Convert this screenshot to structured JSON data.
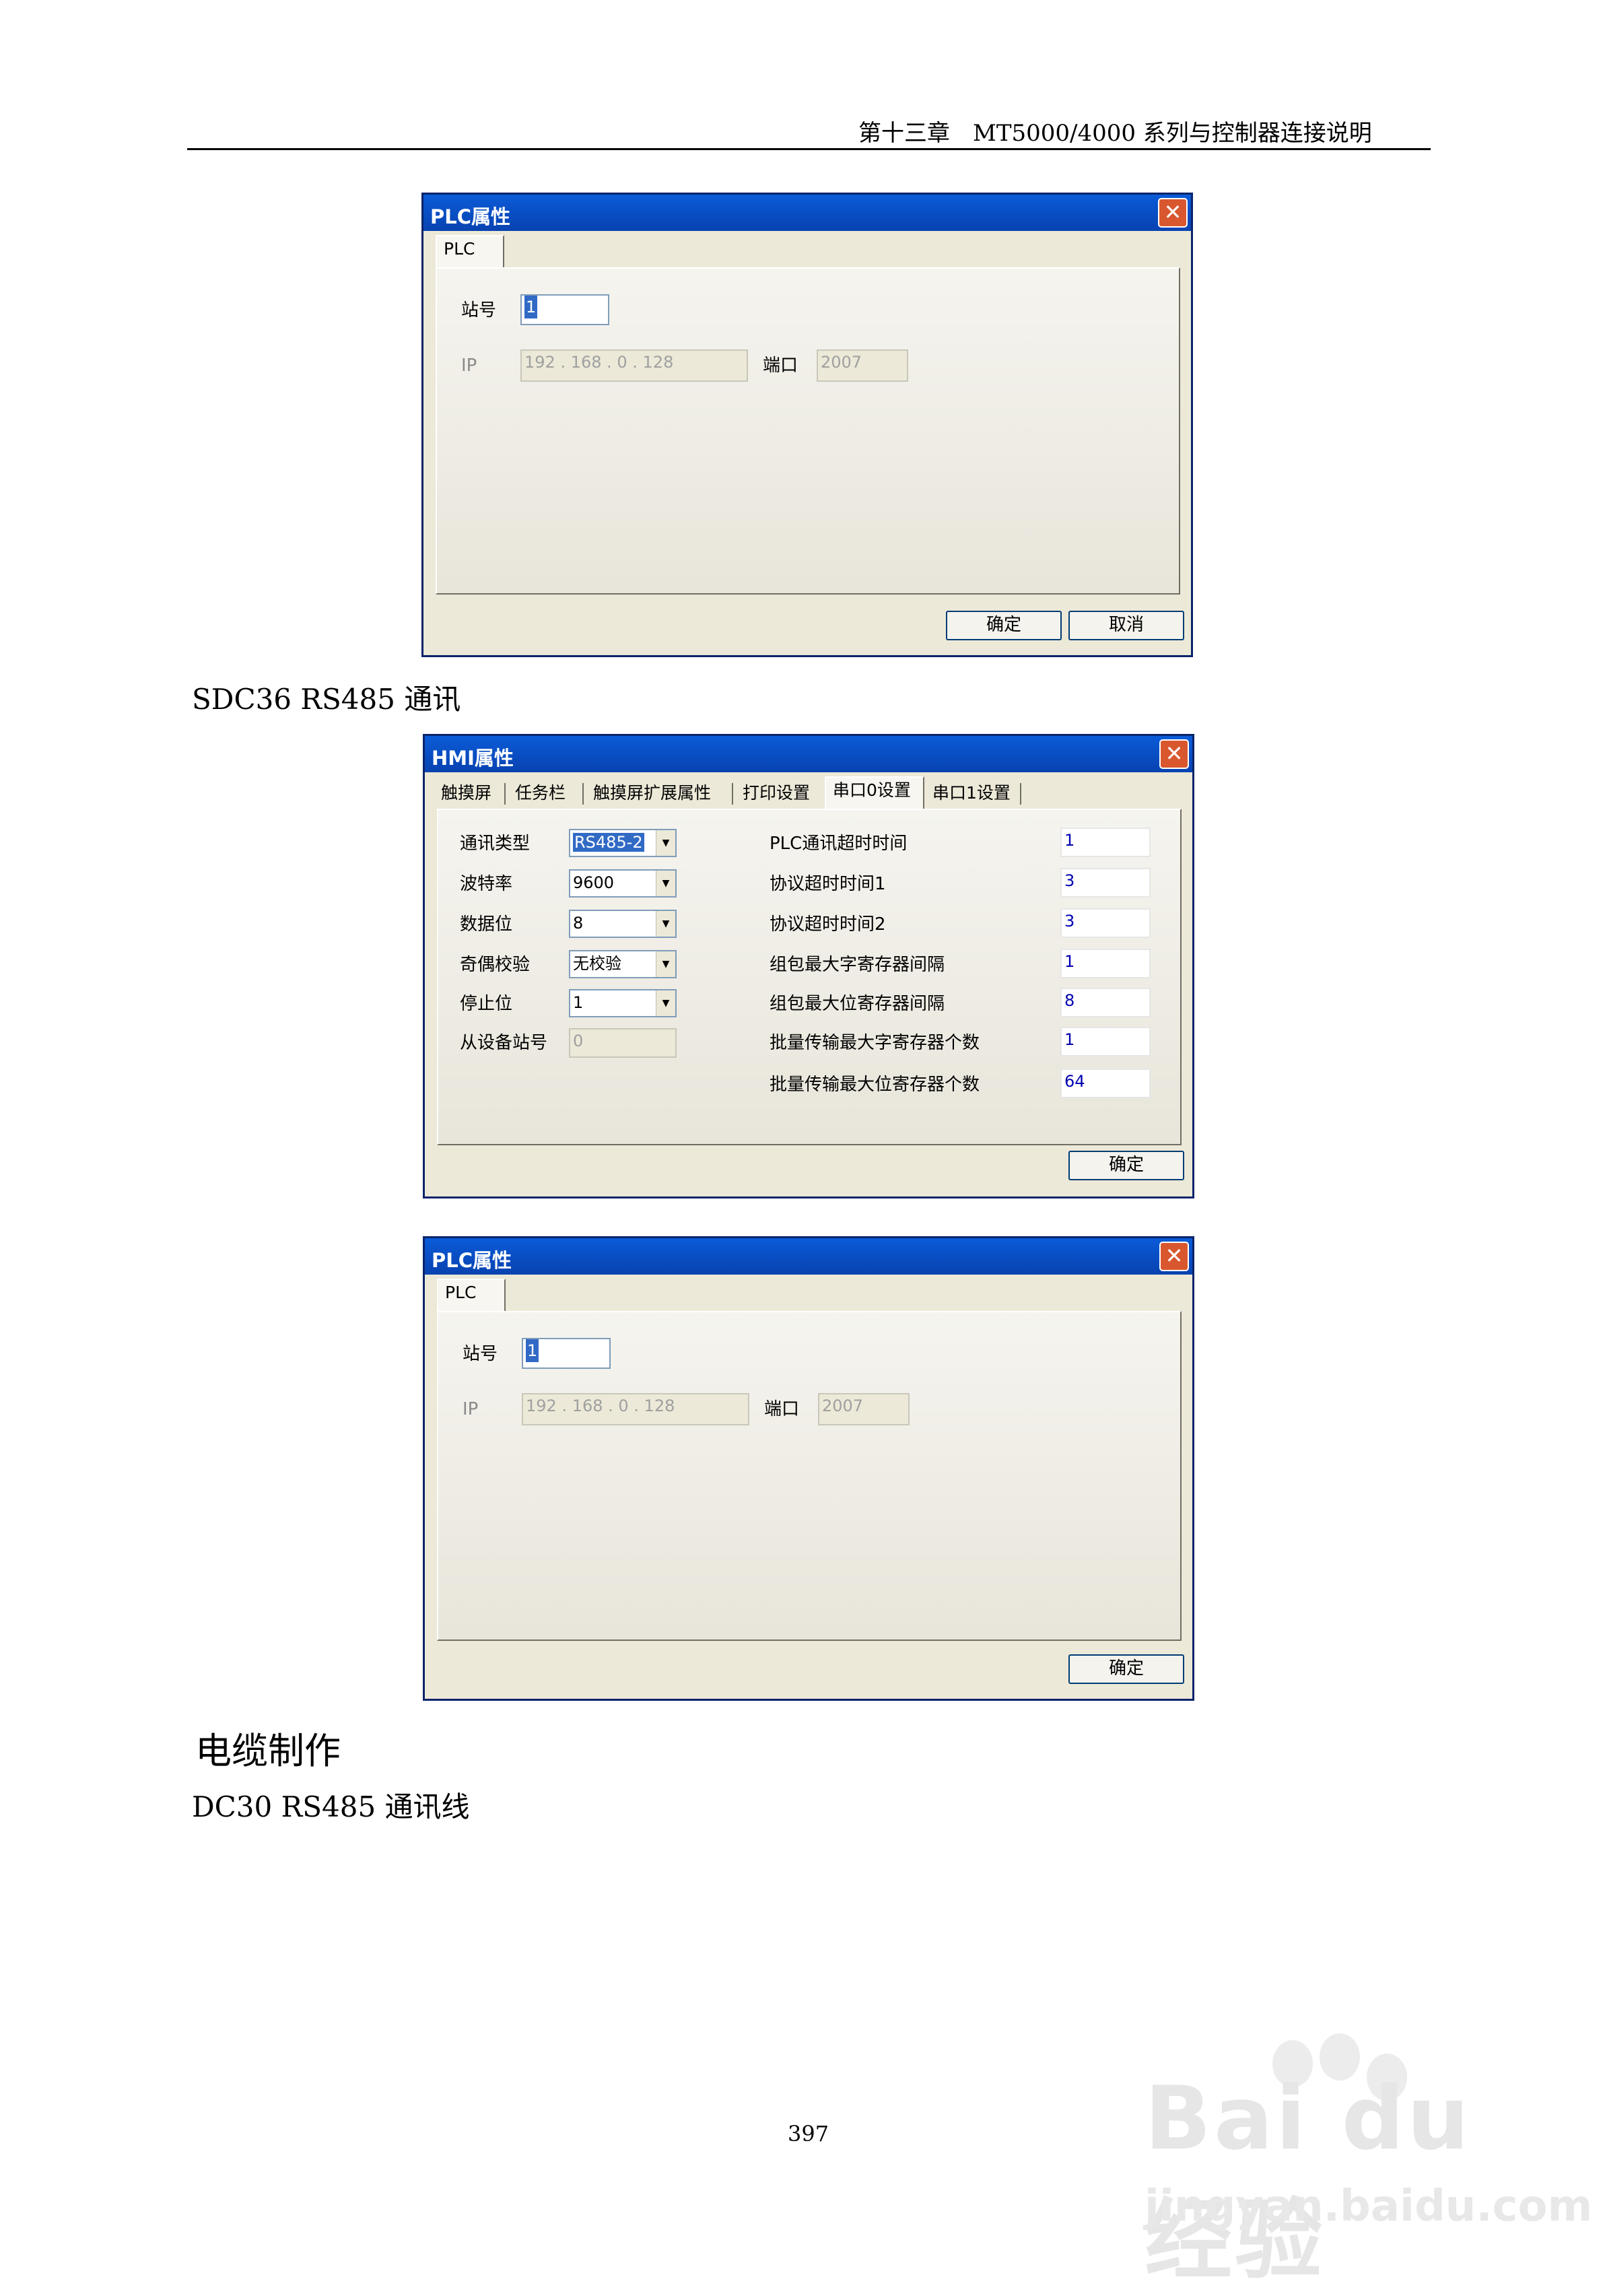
{
  "header": {
    "text": "第十三章　MT5000/4000 系列与控制器连接说明"
  },
  "dialog1": {
    "title": "PLC属性",
    "close": "✕",
    "tab": "PLC",
    "station_label": "站号",
    "station_value": "1",
    "ip_label": "IP",
    "ip_value": "192 . 168 .   0   . 128",
    "port_label": "端口",
    "port_value": "2007",
    "ok": "确定",
    "cancel": "取消"
  },
  "section1": "SDC36  RS485 通讯",
  "dialog2": {
    "title": "HMI属性",
    "close": "✕",
    "tabs": [
      "触摸屏",
      "任务栏",
      "触摸屏扩展属性",
      "打印设置",
      "串口0设置",
      "串口1设置"
    ],
    "left": {
      "comm_type_label": "通讯类型",
      "comm_type_value": "RS485-2",
      "baud_label": "波特率",
      "baud_value": "9600",
      "databits_label": "数据位",
      "databits_value": "8",
      "parity_label": "奇偶校验",
      "parity_value": "无校验",
      "stopbits_label": "停止位",
      "stopbits_value": "1",
      "slave_label": "从设备站号",
      "slave_value": "0"
    },
    "right": [
      {
        "label": "PLC通讯超时时间",
        "value": "1"
      },
      {
        "label": "协议超时时间1",
        "value": "3"
      },
      {
        "label": "协议超时时间2",
        "value": "3"
      },
      {
        "label": "组包最大字寄存器间隔",
        "value": "1"
      },
      {
        "label": "组包最大位寄存器间隔",
        "value": "8"
      },
      {
        "label": "批量传输最大字寄存器个数",
        "value": "1"
      },
      {
        "label": "批量传输最大位寄存器个数",
        "value": "64"
      }
    ],
    "ok": "确定"
  },
  "dialog3": {
    "title": "PLC属性",
    "close": "✕",
    "tab": "PLC",
    "station_label": "站号",
    "station_value": "1",
    "ip_label": "IP",
    "ip_value": "192 . 168 .   0   . 128",
    "port_label": "端口",
    "port_value": "2007",
    "ok": "确定"
  },
  "section2": "电缆制作",
  "section3": "DC30  RS485 通讯线",
  "page_number": "397",
  "watermark": {
    "logo": "Bai du 经验",
    "url": "jingyan.baidu.com"
  }
}
